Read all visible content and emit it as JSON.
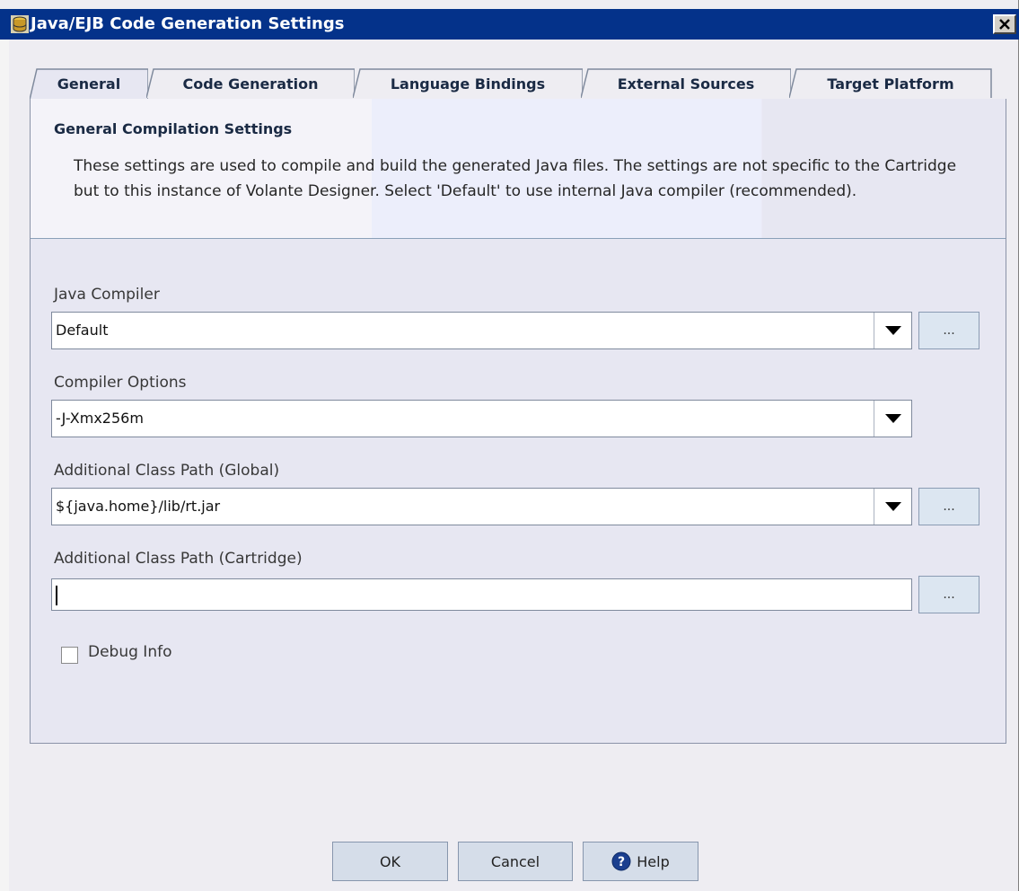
{
  "window": {
    "title": "Java/EJB Code Generation Settings"
  },
  "tabs": [
    {
      "label": "General",
      "active": true
    },
    {
      "label": "Code Generation",
      "active": false
    },
    {
      "label": "Language Bindings",
      "active": false
    },
    {
      "label": "External Sources",
      "active": false
    },
    {
      "label": "Target Platform",
      "active": false
    }
  ],
  "header": {
    "title": "General Compilation Settings",
    "description": "These settings are used to compile and build the generated Java files. The settings are not specific to the Cartridge but to this instance of Volante Designer. Select 'Default' to use internal Java compiler (recommended)."
  },
  "fields": {
    "java_compiler": {
      "label": "Java Compiler",
      "value": "Default",
      "browse": "..."
    },
    "compiler_options": {
      "label": "Compiler Options",
      "value": "-J-Xmx256m"
    },
    "class_path_global": {
      "label": "Additional Class Path (Global)",
      "value": "${java.home}/lib/rt.jar",
      "browse": "..."
    },
    "class_path_cartridge": {
      "label": "Additional Class Path (Cartridge)",
      "value": "",
      "browse": "..."
    }
  },
  "debug_info": {
    "label": "Debug Info",
    "checked": false
  },
  "buttons": {
    "ok": "OK",
    "cancel": "Cancel",
    "help": "Help"
  },
  "colors": {
    "titlebar": "#04328a",
    "panel": "#e7e7f2",
    "button": "#d5dde9"
  },
  "icons": {
    "app": "database-icon",
    "close": "close-icon",
    "dropdown": "triangle-down-icon",
    "help": "help-icon"
  }
}
